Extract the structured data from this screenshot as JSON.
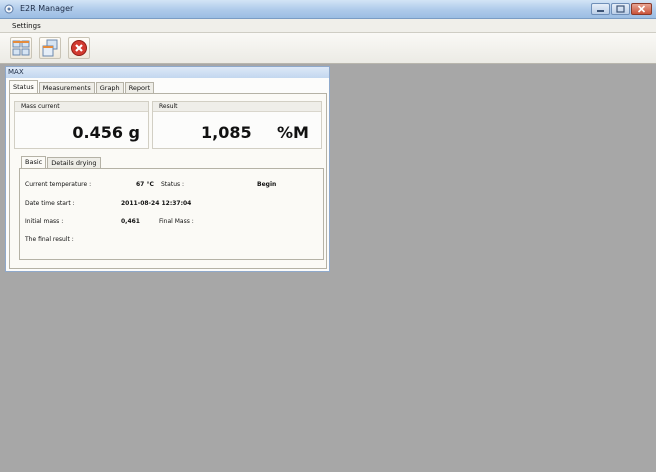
{
  "window": {
    "title": "E2R Manager"
  },
  "menu": {
    "settings": "Settings"
  },
  "child": {
    "title": "MAX",
    "tabs": [
      "Status",
      "Measurements",
      "Graph",
      "Report"
    ]
  },
  "status": {
    "mass_current_label": "Mass current",
    "mass_current_value": "0.456 g",
    "result_label": "Result",
    "result_value": "1,085",
    "result_unit": "%M"
  },
  "subtabs": [
    "Basic",
    "Details drying"
  ],
  "basic": {
    "current_temp_label": "Current temperature :",
    "current_temp_value": "67 °C",
    "status_label": "Status :",
    "status_value": "Begin",
    "date_start_label": "Date time start :",
    "date_start_value": "2011-08-24 12:37:04",
    "initial_mass_label": "Initial mass :",
    "initial_mass_value": "0,461",
    "final_mass_label": "Final Mass :",
    "final_result_label": "The final result :"
  },
  "colors": {
    "workspace": "#a7a7a7",
    "close_icon": "#d23a2f"
  }
}
